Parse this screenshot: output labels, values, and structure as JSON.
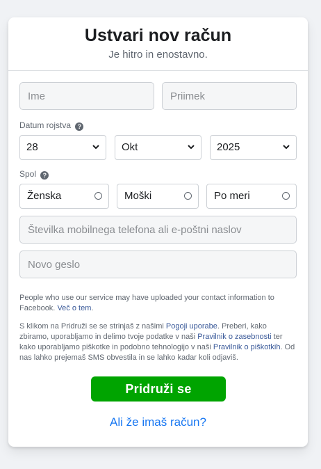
{
  "header": {
    "title": "Ustvari nov račun",
    "subtitle": "Je hitro in enostavno."
  },
  "form": {
    "first_name_placeholder": "Ime",
    "last_name_placeholder": "Priimek",
    "birthday_label": "Datum rojstva",
    "birthday": {
      "day": "28",
      "month": "Okt",
      "year": "2025"
    },
    "gender_label": "Spol",
    "gender_options": [
      "Ženska",
      "Moški",
      "Po meri"
    ],
    "contact_placeholder": "Številka mobilnega telefona ali e-poštni naslov",
    "password_placeholder": "Novo geslo"
  },
  "notices": {
    "contact_upload_text": "People who use our service may have uploaded your contact information to Facebook.",
    "contact_upload_link": "Več o tem",
    "terms_part1": "S klikom na Pridruži se se strinjaš z našimi ",
    "terms_link": "Pogoji uporabe",
    "terms_part2": ". Preberi, kako zbiramo, uporabljamo in delimo tvoje podatke v naši ",
    "privacy_link": "Pravilnik o zasebnosti",
    "terms_part3": " ter kako uporabljamo piškotke in podobno tehnologijo v naši ",
    "cookies_link": "Pravilnik o piškotkih",
    "terms_part4": ". Od nas lahko prejemaš SMS obvestila in se lahko kadar koli odjaviš."
  },
  "actions": {
    "submit_label": "Pridruži se",
    "existing_account_link": "Ali že imaš račun?"
  },
  "colors": {
    "submit": "#00a400",
    "link": "#1877f2",
    "text_link": "#385898"
  },
  "icons": {
    "help": "question-circle-icon",
    "dropdown": "chevron-down-icon"
  }
}
